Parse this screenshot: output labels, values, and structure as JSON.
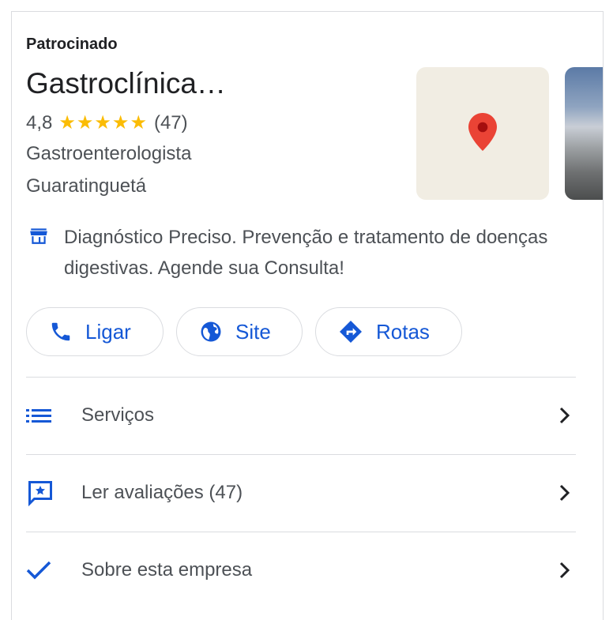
{
  "sponsored_label": "Patrocinado",
  "business": {
    "name": "Gastroclínica…",
    "rating": "4,8",
    "stars": "★★★★★",
    "review_count": "(47)",
    "category": "Gastroenterologista",
    "city": "Guaratinguetá",
    "description": "Diagnóstico Preciso. Prevenção e tratamento de doenças digestivas. Agende sua Consulta!"
  },
  "actions": {
    "call": "Ligar",
    "site": "Site",
    "route": "Rotas"
  },
  "rows": {
    "services": "Serviços",
    "reviews": "Ler avaliações (47)",
    "about": "Sobre esta empresa"
  },
  "colors": {
    "accent": "#1558d6",
    "star": "#fbbc04",
    "pin": "#ea4335"
  },
  "icons": [
    "store-icon",
    "phone-icon",
    "globe-icon",
    "directions-icon",
    "list-icon",
    "review-icon",
    "check-icon",
    "chevron-right-icon",
    "map-pin-icon"
  ]
}
